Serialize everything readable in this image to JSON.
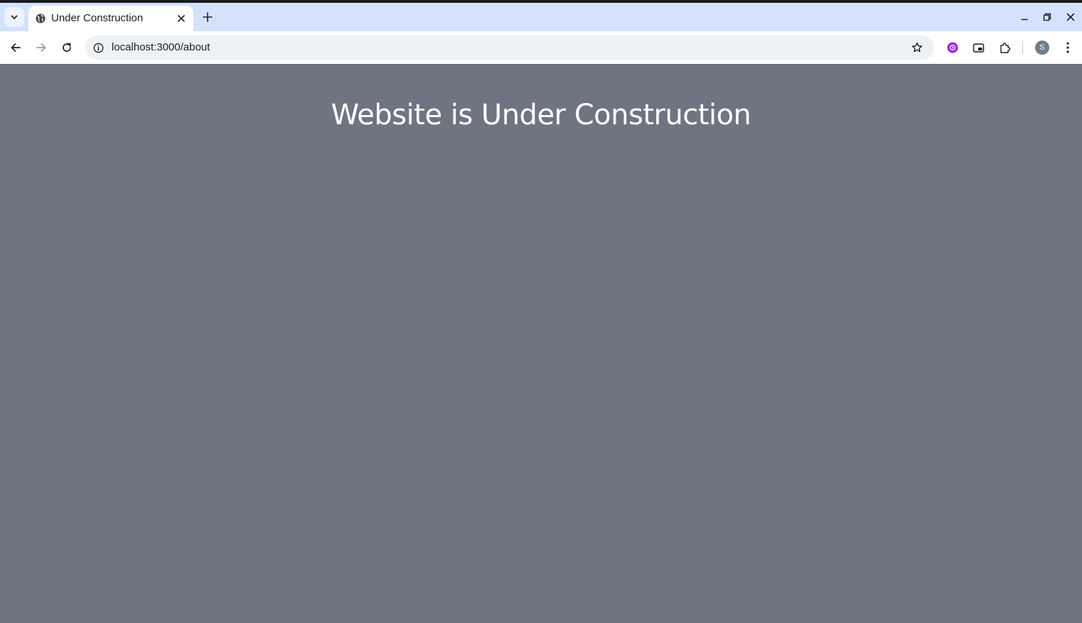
{
  "browser": {
    "tab": {
      "title": "Under Construction"
    },
    "address_bar": {
      "url": "localhost:3000/about"
    },
    "profile_initial": "S",
    "colors": {
      "tab_strip": "#d3e3fd",
      "page_background": "#6e7580",
      "extension_accent": "#a020f0"
    },
    "icons": {
      "tab_search": "chevron-down-icon",
      "favicon": "globe-icon",
      "tab_close": "close-icon",
      "new_tab": "plus-icon",
      "minimize": "minimize-icon",
      "restore": "restore-icon",
      "close_window": "close-icon",
      "back": "arrow-left-icon",
      "forward": "arrow-right-icon",
      "reload": "reload-icon",
      "site_info": "info-icon",
      "bookmark": "star-icon",
      "extension": "extension-icon",
      "picture_in_picture": "picture-in-picture-icon",
      "extensions_menu": "puzzle-icon",
      "menu": "more-vertical-icon"
    }
  },
  "page": {
    "heading": "Website is Under Construction"
  }
}
